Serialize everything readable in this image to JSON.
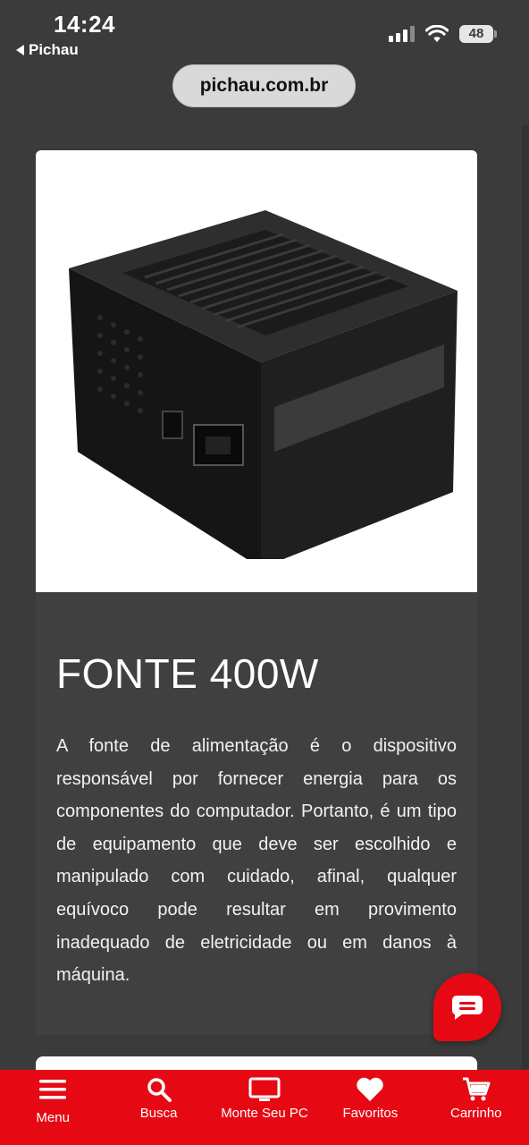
{
  "status_bar": {
    "time": "14:24",
    "back_app": "Pichau",
    "battery": "48"
  },
  "browser": {
    "url": "pichau.com.br"
  },
  "product": {
    "image_alt": "power-supply-photo",
    "title": "FONTE 400W",
    "description": "A fonte de alimentação é o dispositivo responsável por fornecer energia para os componentes do computador. Portanto, é um tipo de equipamento que deve ser escolhido e manipulado com cuidado, afinal, qualquer equívoco pode resultar em provimento inadequado de eletricidade ou em danos à máquina."
  },
  "colors": {
    "brand_red": "#e60914",
    "page_background": "#3b3b3b",
    "card_background": "#404040"
  },
  "bottom_nav": {
    "items": [
      {
        "label": "Menu",
        "icon": "hamburger-icon"
      },
      {
        "label": "Busca",
        "icon": "search-icon"
      },
      {
        "label": "Monte Seu PC",
        "icon": "monitor-icon"
      },
      {
        "label": "Favoritos",
        "icon": "heart-icon"
      },
      {
        "label": "Carrinho",
        "icon": "cart-icon"
      }
    ]
  }
}
